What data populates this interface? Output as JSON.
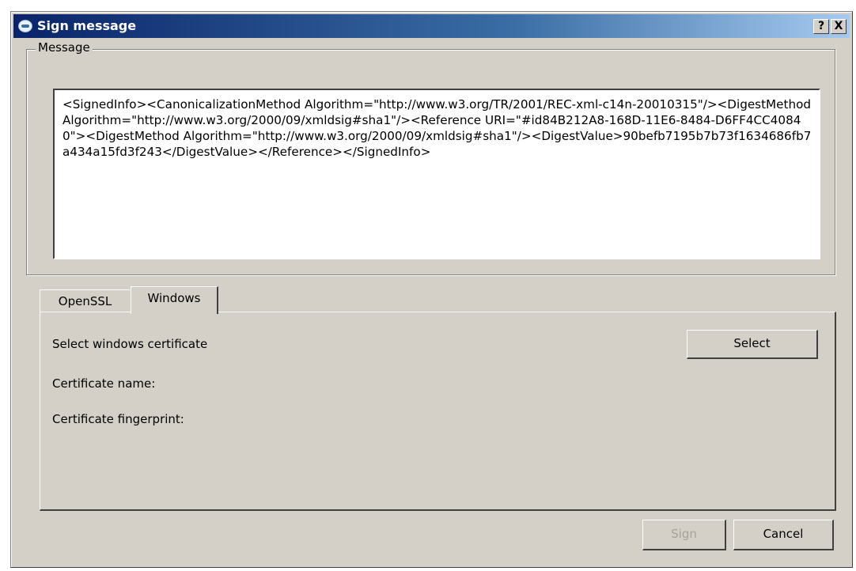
{
  "window": {
    "title": "Sign message",
    "help_glyph": "?",
    "close_glyph": "X",
    "icon": "app-icon"
  },
  "message_group": {
    "legend": "Message",
    "text": "<SignedInfo><CanonicalizationMethod Algorithm=\"http://www.w3.org/TR/2001/REC-xml-c14n-20010315\"/><DigestMethod Algorithm=\"http://www.w3.org/2000/09/xmldsig#sha1\"/><Reference URI=\"#id84B212A8-168D-11E6-8484-D6FF4CC40840\"><DigestMethod Algorithm=\"http://www.w3.org/2000/09/xmldsig#sha1\"/><DigestValue>90befb7195b7b73f1634686fb7a434a15fd3f243</DigestValue></Reference></SignedInfo>"
  },
  "tabs": [
    {
      "label": "OpenSSL",
      "active": false
    },
    {
      "label": "Windows",
      "active": true
    }
  ],
  "windows_panel": {
    "select_label": "Select windows certificate",
    "select_button": "Select",
    "cert_name_label": "Certificate name:",
    "cert_fingerprint_label": "Certificate fingerprint:"
  },
  "buttons": {
    "sign": "Sign",
    "cancel": "Cancel"
  }
}
